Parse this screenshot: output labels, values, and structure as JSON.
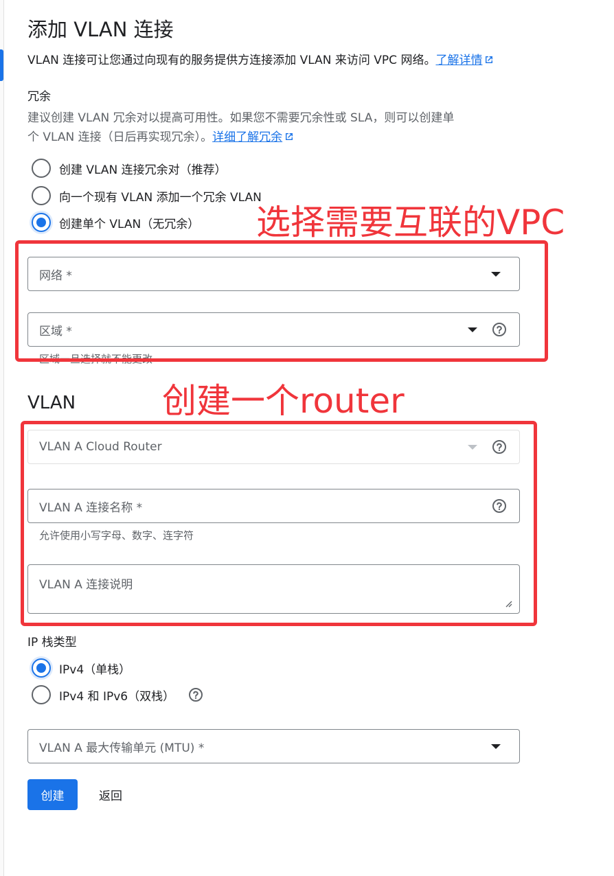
{
  "page": {
    "title": "添加 VLAN 连接",
    "description": "VLAN 连接可让您通过向现有的服务提供方连接添加 VLAN 来访问 VPC 网络。",
    "learn_more": "了解详情"
  },
  "redundancy": {
    "label": "冗余",
    "help_line1": "建议创建 VLAN 冗余对以提高可用性。如果您不需要冗余性或 SLA，则可以创建单",
    "help_line2": "个 VLAN 连接（日后再实现冗余）。",
    "help_link": "详细了解冗余",
    "options": [
      {
        "label": "创建 VLAN 连接冗余对（推荐）",
        "checked": false
      },
      {
        "label": "向一个现有 VLAN 添加一个冗余 VLAN",
        "checked": false
      },
      {
        "label": "创建单个 VLAN（无冗余）",
        "checked": true
      }
    ]
  },
  "fields": {
    "network": "网络 *",
    "region": "区域 *",
    "region_hint": "区域一旦选择就不能更改"
  },
  "vlan": {
    "heading": "VLAN",
    "cloud_router": "VLAN A Cloud Router",
    "connection_name": "VLAN A 连接名称 *",
    "connection_name_hint": "允许使用小写字母、数字、连字符",
    "connection_desc": "VLAN A 连接说明"
  },
  "ip_stack": {
    "label": "IP 栈类型",
    "options": [
      {
        "label": "IPv4（单栈）",
        "checked": true
      },
      {
        "label": "IPv4 和 IPv6（双栈）",
        "checked": false
      }
    ]
  },
  "mtu": {
    "label": "VLAN A 最大传输单元 (MTU) *"
  },
  "actions": {
    "create": "创建",
    "back": "返回"
  },
  "annotations": {
    "select_vpc": "选择需要互联的VPC",
    "create_router": "创建一个router"
  },
  "colors": {
    "accent": "#1a73e8",
    "annotation": "#f0353b"
  }
}
